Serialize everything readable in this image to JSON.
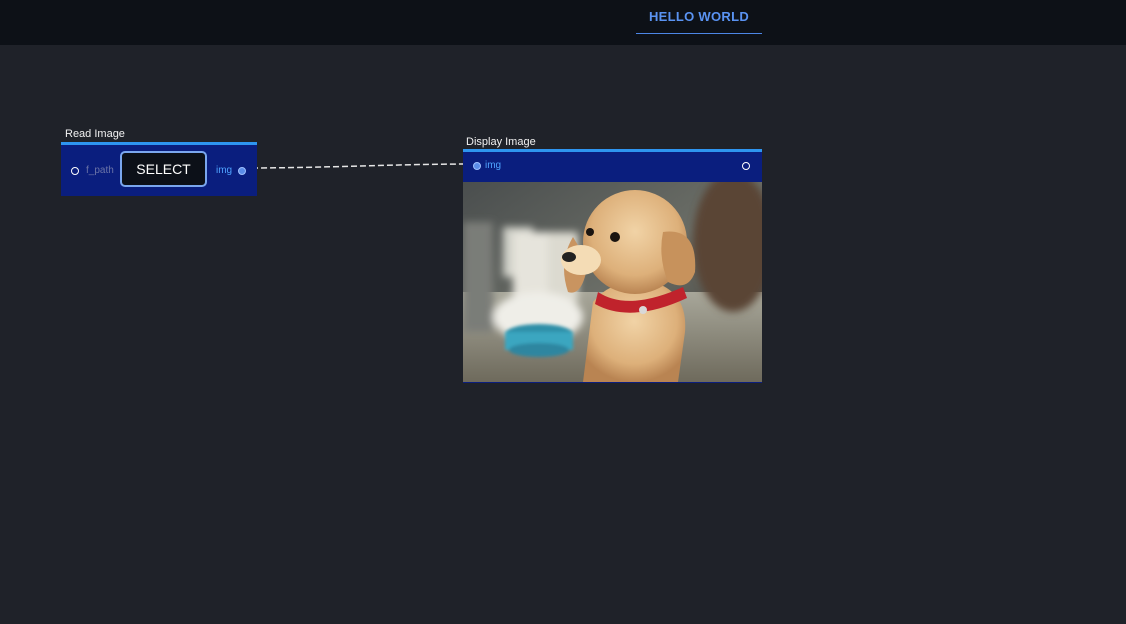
{
  "header": {
    "tabs": [
      {
        "label": "HELLO WORLD",
        "active": true
      }
    ]
  },
  "nodes": {
    "read_image": {
      "title": "Read Image",
      "input_port_label": "f_path",
      "button_label": "SELECT",
      "output_port_label": "img"
    },
    "display_image": {
      "title": "Display Image",
      "input_port_label": "img",
      "preview_icon": "puppy-photo"
    }
  },
  "colors": {
    "background": "#1f2229",
    "topbar": "#0d1117",
    "accent": "#5a93f2",
    "node_body": "#0a1e7e",
    "node_border": "#2e95f0"
  }
}
